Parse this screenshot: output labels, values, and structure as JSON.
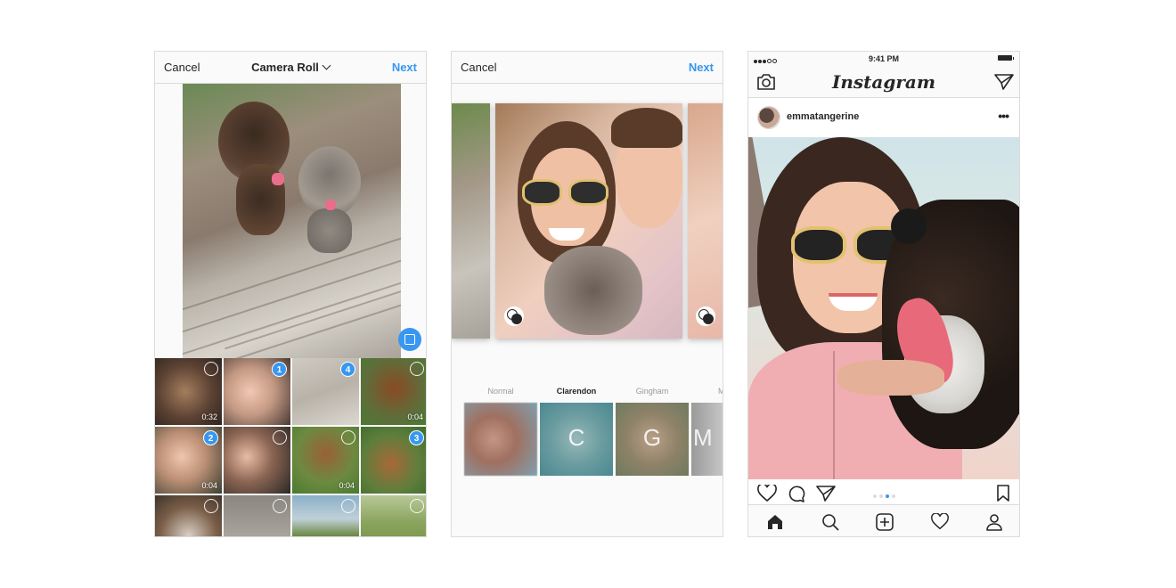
{
  "panel_select": {
    "cancel": "Cancel",
    "title": "Camera Roll",
    "next": "Next",
    "grid": [
      {
        "selected": false,
        "badge": "",
        "duration": "0:32"
      },
      {
        "selected": true,
        "badge": "1",
        "duration": ""
      },
      {
        "selected": true,
        "badge": "4",
        "duration": ""
      },
      {
        "selected": false,
        "badge": "",
        "duration": "0:04"
      },
      {
        "selected": true,
        "badge": "2",
        "duration": "0:04"
      },
      {
        "selected": false,
        "badge": "",
        "duration": ""
      },
      {
        "selected": false,
        "badge": "",
        "duration": "0:04"
      },
      {
        "selected": true,
        "badge": "3",
        "duration": ""
      },
      {
        "selected": false,
        "badge": "",
        "duration": ""
      },
      {
        "selected": false,
        "badge": "",
        "duration": ""
      },
      {
        "selected": false,
        "badge": "",
        "duration": ""
      },
      {
        "selected": false,
        "badge": "",
        "duration": ""
      }
    ]
  },
  "panel_filter": {
    "cancel": "Cancel",
    "next": "Next",
    "filters": [
      {
        "name": "Normal",
        "letter": "",
        "active": false
      },
      {
        "name": "Clarendon",
        "letter": "C",
        "active": true
      },
      {
        "name": "Gingham",
        "letter": "G",
        "active": false
      },
      {
        "name": "M",
        "letter": "M",
        "active": false
      }
    ]
  },
  "panel_feed": {
    "status_time": "9:41 PM",
    "app_name": "Instagram",
    "username": "emmatangerine",
    "more": "•••",
    "carousel_pages": 4,
    "carousel_current": 3
  },
  "colors": {
    "accent": "#3897f0",
    "text": "#262626",
    "border": "#dbdbdb"
  }
}
